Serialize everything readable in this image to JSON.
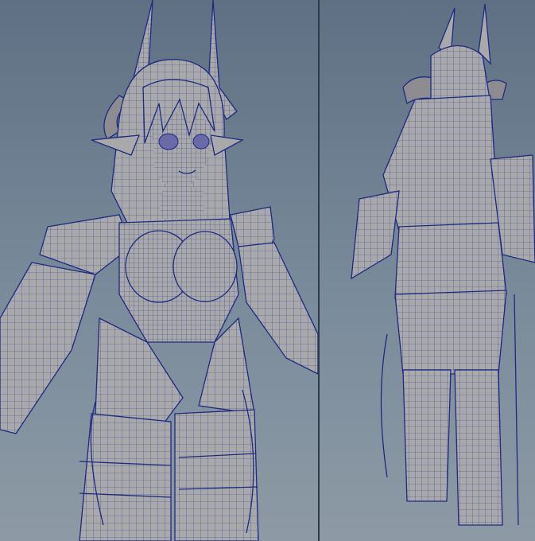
{
  "app": {
    "viewports": [
      {
        "name": "front-perspective-view",
        "background": "#6f8091"
      },
      {
        "name": "back-perspective-view",
        "background": "#6f8091"
      }
    ],
    "display_mode": "wireframe-on-shaded",
    "mesh_color": "#a9a9ab",
    "wire_color": "#1d2a80"
  }
}
